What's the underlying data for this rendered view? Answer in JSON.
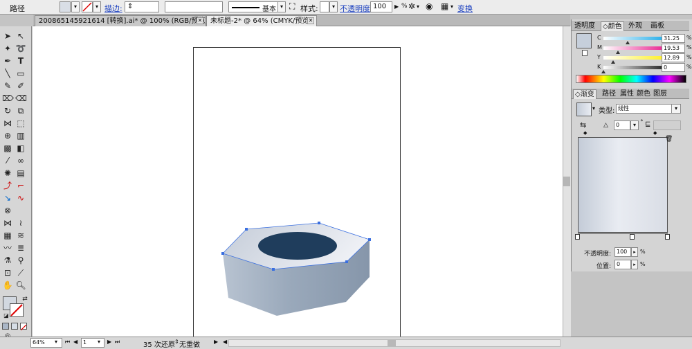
{
  "control_bar": {
    "object_type": "路径",
    "stroke_link": "描边:",
    "stroke_profile": "基本",
    "style_label": "样式:",
    "opacity_link": "不透明度:",
    "opacity_value": "100",
    "opacity_unit": "%",
    "transform_link": "变换"
  },
  "tabs": [
    {
      "label": "200865145921614   [转换].ai* @ 100% (RGB/预览)"
    },
    {
      "label": "未标题-2* @ 64% (CMYK/预览)"
    }
  ],
  "color_panel": {
    "tabs": [
      "透明度",
      "颜色",
      "外观",
      "画板"
    ],
    "active_tab": "颜色",
    "channels": [
      {
        "label": "C",
        "value": "31.25",
        "color": "#00a0e6",
        "fraction": 0.3125
      },
      {
        "label": "M",
        "value": "19.53",
        "color": "#e6007e",
        "fraction": 0.1953
      },
      {
        "label": "Y",
        "value": "12.89",
        "color": "#ffed00",
        "fraction": 0.1289
      },
      {
        "label": "K",
        "value": "0",
        "color": "#000000",
        "fraction": 0.0
      }
    ],
    "unit": "%"
  },
  "gradient_panel": {
    "tabs": [
      "渐变",
      "路径",
      "属性",
      "颜色",
      "图层"
    ],
    "active_tab": "渐变",
    "type_label": "类型:",
    "type_value": "线性",
    "angle_value": "0",
    "angle_unit": "°",
    "opacity_label": "不透明度:",
    "opacity_value": "100",
    "location_label": "位置:",
    "location_value": "0",
    "unit": "%"
  },
  "status_bar": {
    "zoom": "64%",
    "page": "1",
    "undo_text": "35 次还原",
    "redo_text": "无重做"
  },
  "colors": {
    "gradient_start": "#c4ccd8",
    "gradient_end": "#e9ecf2",
    "hole": "#1f3d5c",
    "selection": "#3a6fe0"
  }
}
